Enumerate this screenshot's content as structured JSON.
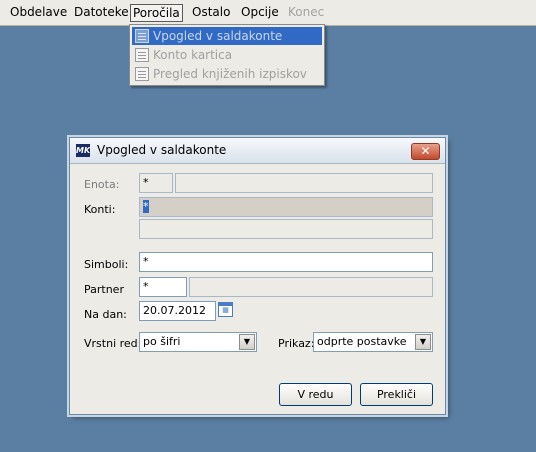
{
  "menubar": {
    "items": [
      "Obdelave",
      "Datoteke",
      "Poročila",
      "Ostalo",
      "Opcije",
      "Konec"
    ]
  },
  "menu_dropdown": {
    "items": [
      {
        "label": "Vpogled v saldakonte",
        "highlighted": true
      },
      {
        "label": "Konto kartica",
        "highlighted": false
      },
      {
        "label": "Pregled knjiženih izpiskov",
        "highlighted": false
      }
    ]
  },
  "dialog": {
    "logo_text": "MK",
    "title": "Vpogled v saldakonte",
    "close_glyph": "✕",
    "enota": {
      "label": "Enota:",
      "value": "*"
    },
    "konti": {
      "label": "Konti:",
      "value": "*"
    },
    "simboli": {
      "label": "Simboli:",
      "value": "*"
    },
    "partner": {
      "label": "Partner",
      "value": "*"
    },
    "na_dan": {
      "label": "Na dan:",
      "value": "20.07.2012"
    },
    "vrstni_red": {
      "label": "Vrstni red:",
      "value": "po šifri"
    },
    "prikaz": {
      "label": "Prikaz:",
      "value": "odprte postavke"
    },
    "ok_label": "V redu",
    "cancel_label": "Prekliči",
    "calendar_glyph": "▦",
    "dropdown_arrow": "▼"
  },
  "colors": {
    "desktop": "#5b7fa3",
    "highlight": "#316ac5",
    "close_button": "#c24a2c"
  }
}
